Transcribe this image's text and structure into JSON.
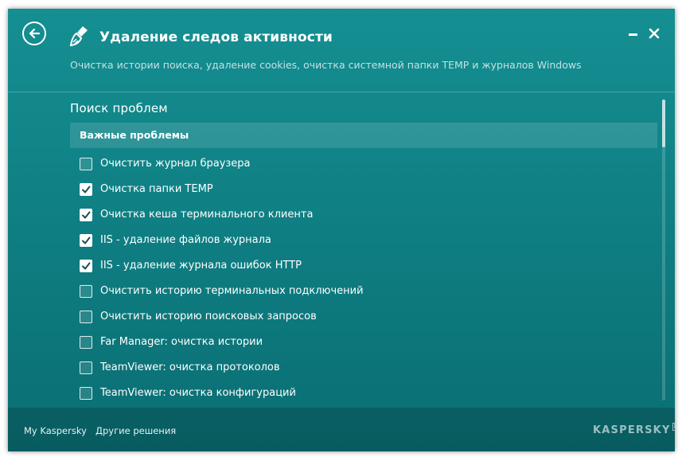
{
  "header": {
    "title": "Удаление следов активности",
    "subtitle": "Очистка истории поиска, удаление cookies, очистка системной папки TEMP и журналов Windows"
  },
  "section": {
    "title": "Поиск проблем",
    "group_title": "Важные проблемы"
  },
  "items": [
    {
      "label": "Очистить журнал браузера",
      "checked": false
    },
    {
      "label": "Очистка папки TEMP",
      "checked": true
    },
    {
      "label": "Очистка кеша терминального клиента",
      "checked": true
    },
    {
      "label": "IIS - удаление файлов журнала",
      "checked": true
    },
    {
      "label": "IIS - удаление журнала ошибок HTTP",
      "checked": true
    },
    {
      "label": "Очистить историю терминальных подключений",
      "checked": false
    },
    {
      "label": "Очистить историю поисковых запросов",
      "checked": false
    },
    {
      "label": "Far Manager: очистка истории",
      "checked": false
    },
    {
      "label": "TeamViewer: очистка протоколов",
      "checked": false
    },
    {
      "label": "TeamViewer: очистка конфигураций",
      "checked": false
    }
  ],
  "footer": {
    "my_kaspersky": "My Kaspersky",
    "other_solutions": "Другие решения",
    "brand": "KASPERSKY",
    "brand_suffix": "lab"
  },
  "icons": {
    "back": "back-arrow-icon",
    "app": "broom-icon",
    "minimize": "minimize-icon",
    "close": "close-icon",
    "checkmark": "checkmark-icon"
  },
  "colors": {
    "window_bg": "#0f8084",
    "accent_text": "#ffffff",
    "subtitle_text": "#c2e2e3"
  }
}
